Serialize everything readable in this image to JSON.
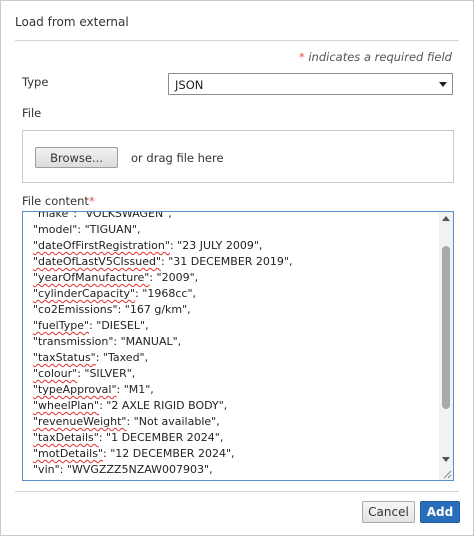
{
  "dialog": {
    "title": "Load from external",
    "required_note_star": "*",
    "required_note_text": " indicates a required field"
  },
  "type_field": {
    "label": "Type",
    "value": "JSON"
  },
  "file_field": {
    "label": "File",
    "browse_label": "Browse...",
    "drag_text": "or drag file here"
  },
  "content_field": {
    "label": "File content",
    "required_star": "*",
    "lines": [
      {
        "key": "\"make\"",
        "rest": ": \"VOLKSWAGEN\",",
        "squiggle": false
      },
      {
        "key": "\"model\"",
        "rest": ": \"TIGUAN\",",
        "squiggle": false
      },
      {
        "key": "\"dateOfFirstRegistration\"",
        "rest": ": \"23 JULY 2009\",",
        "squiggle": true
      },
      {
        "key": "\"dateOfLastV5CIssued\"",
        "rest": ": \"31 DECEMBER 2019\",",
        "squiggle": true
      },
      {
        "key": "\"yearOfManufacture\"",
        "rest": ": \"2009\",",
        "squiggle": true
      },
      {
        "key": "\"cylinderCapacity\"",
        "rest": ": \"1968cc\",",
        "squiggle": true
      },
      {
        "key": "\"co2Emissions\"",
        "rest": ": \"167 g/km\",",
        "squiggle": false
      },
      {
        "key": "\"fuelType\"",
        "rest": ": \"DIESEL\",",
        "squiggle": true
      },
      {
        "key": "\"transmission\"",
        "rest": ": \"MANUAL\",",
        "squiggle": false
      },
      {
        "key": "\"taxStatus\"",
        "rest": ": \"Taxed\",",
        "squiggle": true
      },
      {
        "key": "\"colour\"",
        "rest": ": \"SILVER\",",
        "squiggle": true
      },
      {
        "key": "\"typeApproval\"",
        "rest": ": \"M1\",",
        "squiggle": true
      },
      {
        "key": "\"wheelPlan\"",
        "rest": ": \"2 AXLE RIGID BODY\",",
        "squiggle": true
      },
      {
        "key": "\"revenueWeight\"",
        "rest": ": \"Not available\",",
        "squiggle": true
      },
      {
        "key": "\"taxDetails\"",
        "rest": ": \"1 DECEMBER 2024\",",
        "squiggle": true
      },
      {
        "key": "\"motDetails\"",
        "rest": ": \"12 DECEMBER 2024\",",
        "squiggle": true
      },
      {
        "key": "\"vin\"",
        "rest": ": \"WVGZZZ5NZAW007903\",",
        "squiggle": false
      }
    ]
  },
  "footer": {
    "cancel_label": "Cancel",
    "add_label": "Add"
  },
  "colors": {
    "accent": "#2a6ebb",
    "required": "#d9534f",
    "textarea_border": "#5b8fc7"
  }
}
